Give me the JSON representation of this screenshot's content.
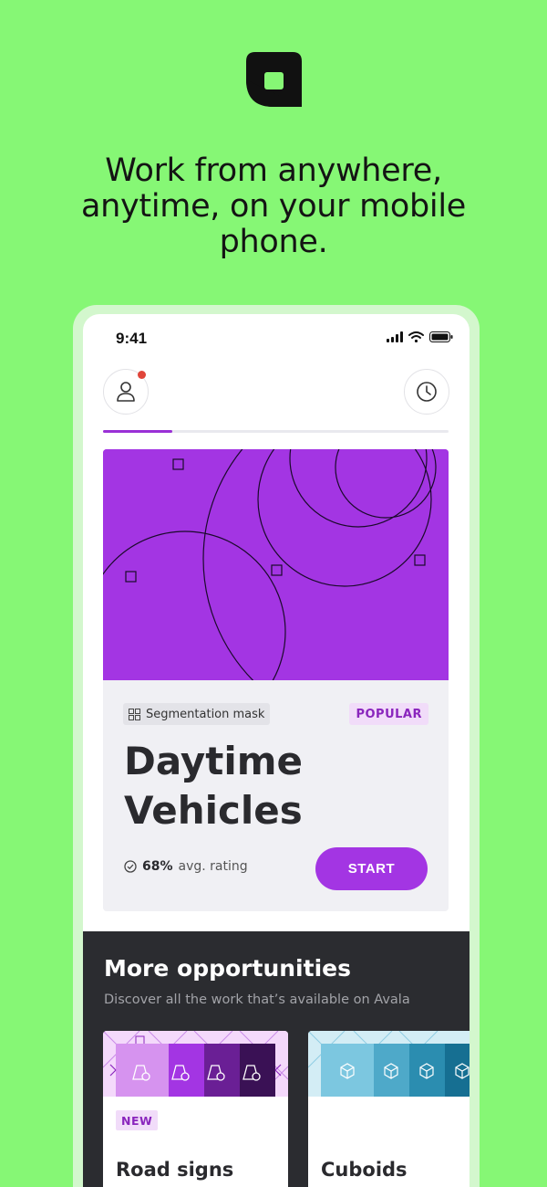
{
  "headline": [
    "Work from anywhere,",
    "anytime, on your mobile",
    "phone."
  ],
  "status_bar": {
    "time": "9:41"
  },
  "top_bar": {
    "progress": 0.2
  },
  "task_card": {
    "type_label": "Segmentation mask",
    "badge": "POPULAR",
    "title": [
      "Daytime",
      "Vehicles"
    ],
    "rating_value": "68%",
    "rating_label": "avg. rating",
    "start_label": "START"
  },
  "more": {
    "title": "More opportunities",
    "subtitle": "Discover all the work that’s available on Avala",
    "cards": [
      {
        "badge": "NEW",
        "title": "Road signs",
        "icon": "road-sign-icon"
      },
      {
        "badge": "",
        "title": "Cuboids",
        "icon": "cube-icon"
      }
    ]
  },
  "colors": {
    "background": "#86f775",
    "accent": "#a335e3",
    "dark_section": "#2b2c30",
    "notification": "#e0453a"
  }
}
